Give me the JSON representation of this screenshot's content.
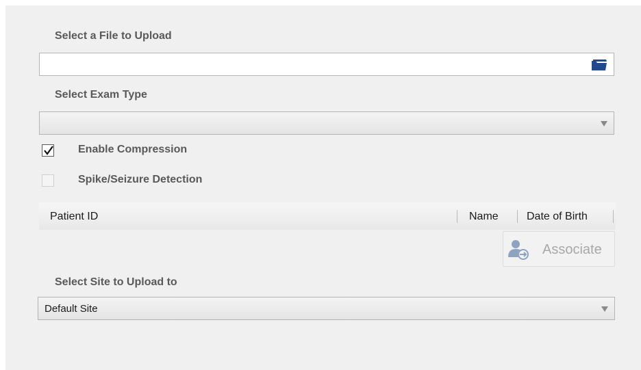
{
  "upload": {
    "file_label": "Select a File to Upload",
    "file_value": "",
    "folder_icon": "folder-open-icon"
  },
  "exam": {
    "label": "Select Exam Type",
    "value": ""
  },
  "options": {
    "compression_label": "Enable Compression",
    "compression_checked": true,
    "spike_label": "Spike/Seizure Detection",
    "spike_checked": false,
    "spike_disabled": true
  },
  "patient_table": {
    "columns": [
      "Patient ID",
      "Name",
      "Date of Birth"
    ]
  },
  "associate": {
    "label": "Associate",
    "icon": "user-associate-icon",
    "enabled": false
  },
  "site": {
    "label": "Select Site to Upload to",
    "value": "Default Site"
  },
  "colors": {
    "panel_bg": "#f0f0f0",
    "label_text": "#595959",
    "folder_icon": "#1f4b8e",
    "disabled_text": "#a8a8a8"
  }
}
